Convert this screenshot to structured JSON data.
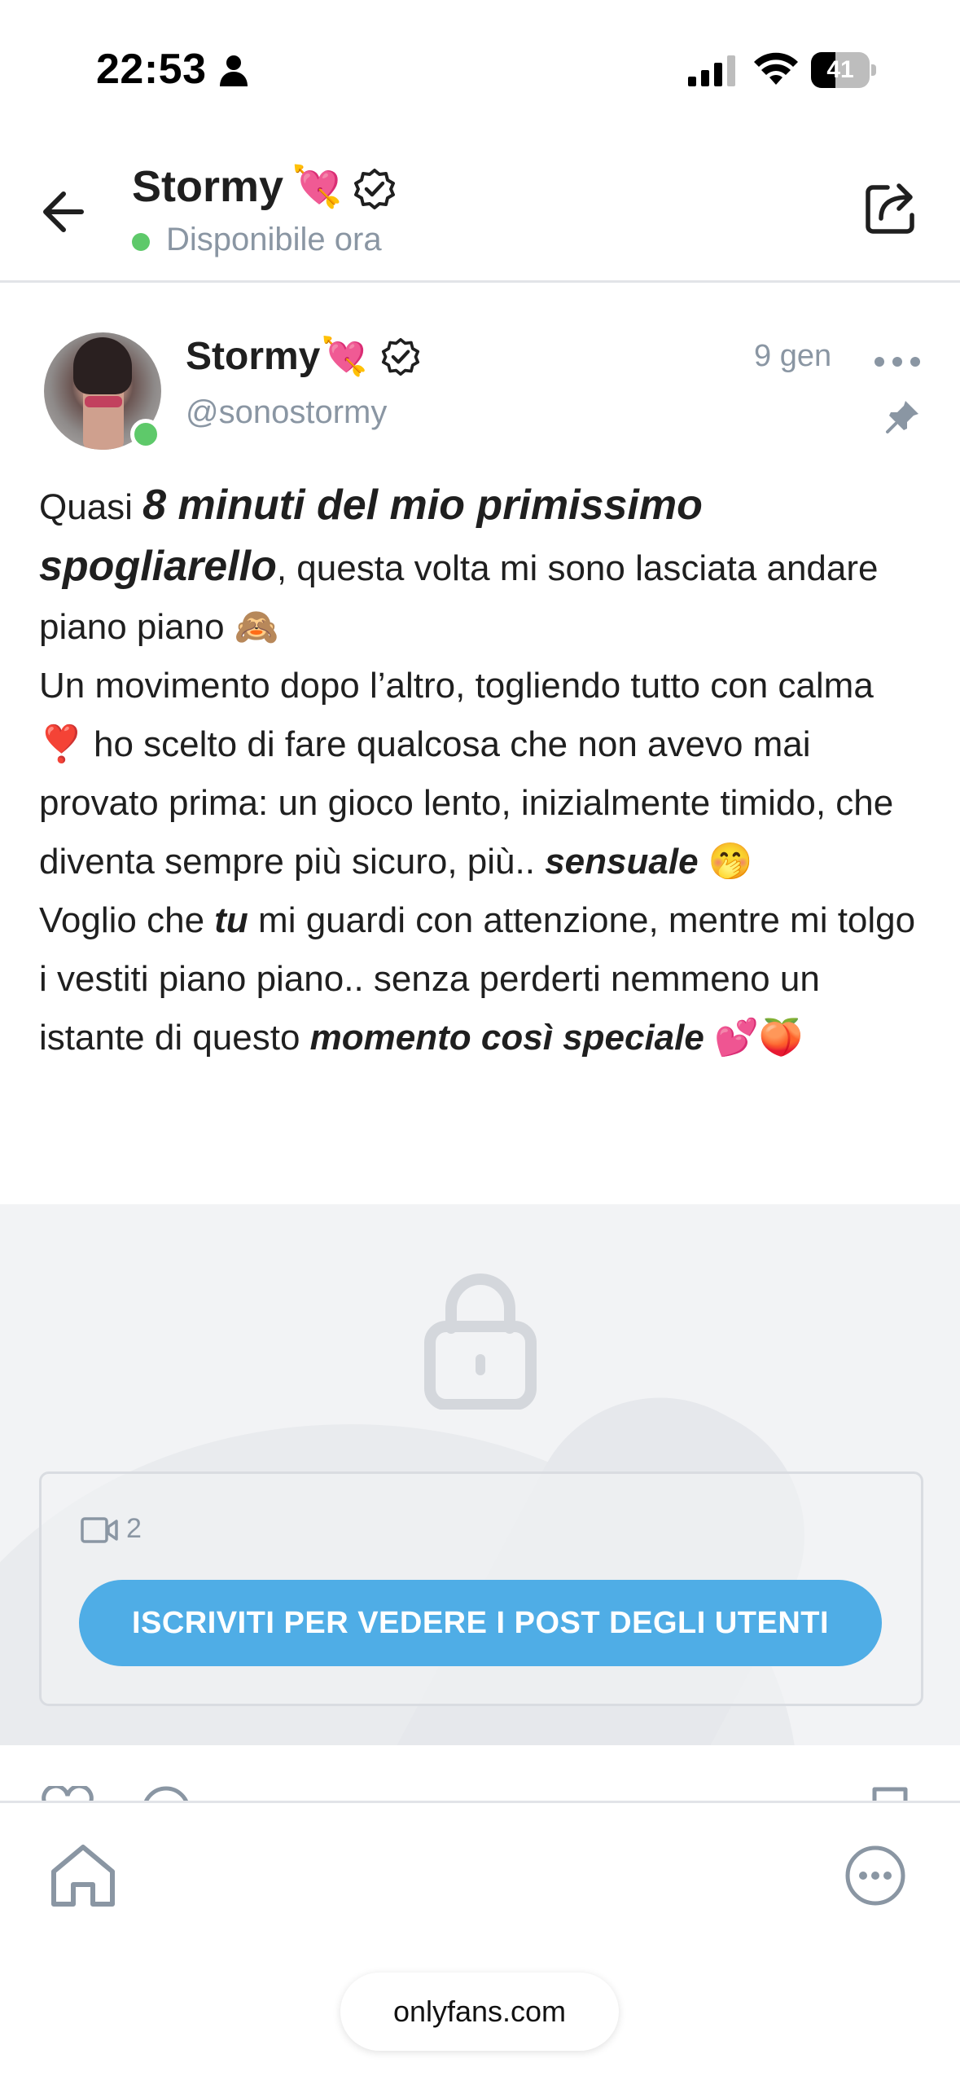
{
  "status_bar": {
    "time": "22:53",
    "battery": "41",
    "battery_level": 0.41,
    "icons": [
      "person-icon",
      "signal-icon",
      "wifi-icon",
      "battery-icon"
    ]
  },
  "header": {
    "title": "Stormy",
    "emoji": "💘",
    "status": "Disponibile ora",
    "icons": [
      "back-arrow-icon",
      "verified-badge-icon",
      "share-icon"
    ]
  },
  "post": {
    "name": "Stormy",
    "emoji": "💘",
    "handle": "@sonostormy",
    "date": "9 gen",
    "text": {
      "p1_a": "Quasi ",
      "p1_b": "8 minuti del mio primissimo spogliarello",
      "p1_c": ", questa volta mi sono lasciata andare piano piano 🙈",
      "p2_a": "Un movimento dopo l’altro, togliendo tutto con calma ❣️ ho scelto di fare qualcosa che non avevo mai provato prima: un gioco lento, inizialmente timido, che diventa sempre più sicuro, più.. ",
      "p2_b": "sensuale",
      "p2_c": " 🤭",
      "p3_a": "Voglio che ",
      "p3_b": "tu",
      "p3_c": " mi guardi con attenzione, mentre mi tolgo i vestiti piano piano.. senza perderti nemmeno un istante di questo ",
      "p3_d": "momento così speciale",
      "p3_e": " 💕🍑"
    },
    "icons": [
      "more-dots-icon",
      "pin-icon"
    ]
  },
  "locked": {
    "video_count": "2",
    "subscribe_label": "ISCRIVITI PER VEDERE I POST DEGLI UTENTI",
    "icons": [
      "lock-icon",
      "video-icon"
    ]
  },
  "actions": {
    "icons": [
      "heart-icon",
      "comment-icon",
      "bookmark-icon"
    ]
  },
  "bottom_nav": {
    "url": "onlyfans.com",
    "icons": [
      "home-icon",
      "more-circle-icon"
    ]
  },
  "colors": {
    "accent": "#4fade6",
    "online": "#5ec96a",
    "muted_text": "#8a96a3",
    "locked_bg": "#f2f3f5"
  }
}
